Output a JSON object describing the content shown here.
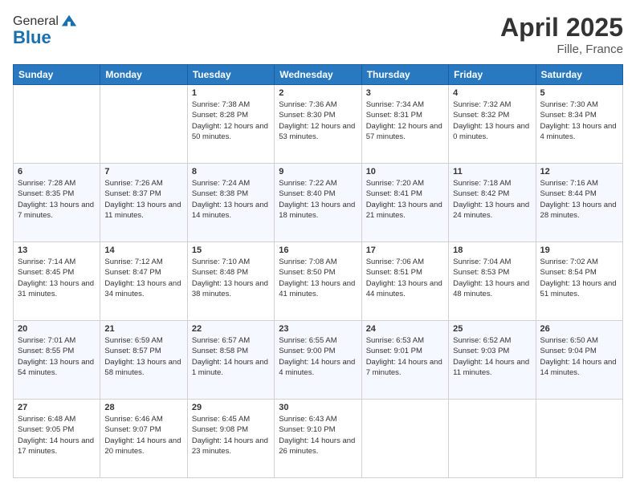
{
  "header": {
    "logo_general": "General",
    "logo_blue": "Blue",
    "title": "April 2025",
    "location": "Fille, France"
  },
  "days_of_week": [
    "Sunday",
    "Monday",
    "Tuesday",
    "Wednesday",
    "Thursday",
    "Friday",
    "Saturday"
  ],
  "weeks": [
    [
      {
        "day": "",
        "sunrise": "",
        "sunset": "",
        "daylight": ""
      },
      {
        "day": "",
        "sunrise": "",
        "sunset": "",
        "daylight": ""
      },
      {
        "day": "1",
        "sunrise": "Sunrise: 7:38 AM",
        "sunset": "Sunset: 8:28 PM",
        "daylight": "Daylight: 12 hours and 50 minutes."
      },
      {
        "day": "2",
        "sunrise": "Sunrise: 7:36 AM",
        "sunset": "Sunset: 8:30 PM",
        "daylight": "Daylight: 12 hours and 53 minutes."
      },
      {
        "day": "3",
        "sunrise": "Sunrise: 7:34 AM",
        "sunset": "Sunset: 8:31 PM",
        "daylight": "Daylight: 12 hours and 57 minutes."
      },
      {
        "day": "4",
        "sunrise": "Sunrise: 7:32 AM",
        "sunset": "Sunset: 8:32 PM",
        "daylight": "Daylight: 13 hours and 0 minutes."
      },
      {
        "day": "5",
        "sunrise": "Sunrise: 7:30 AM",
        "sunset": "Sunset: 8:34 PM",
        "daylight": "Daylight: 13 hours and 4 minutes."
      }
    ],
    [
      {
        "day": "6",
        "sunrise": "Sunrise: 7:28 AM",
        "sunset": "Sunset: 8:35 PM",
        "daylight": "Daylight: 13 hours and 7 minutes."
      },
      {
        "day": "7",
        "sunrise": "Sunrise: 7:26 AM",
        "sunset": "Sunset: 8:37 PM",
        "daylight": "Daylight: 13 hours and 11 minutes."
      },
      {
        "day": "8",
        "sunrise": "Sunrise: 7:24 AM",
        "sunset": "Sunset: 8:38 PM",
        "daylight": "Daylight: 13 hours and 14 minutes."
      },
      {
        "day": "9",
        "sunrise": "Sunrise: 7:22 AM",
        "sunset": "Sunset: 8:40 PM",
        "daylight": "Daylight: 13 hours and 18 minutes."
      },
      {
        "day": "10",
        "sunrise": "Sunrise: 7:20 AM",
        "sunset": "Sunset: 8:41 PM",
        "daylight": "Daylight: 13 hours and 21 minutes."
      },
      {
        "day": "11",
        "sunrise": "Sunrise: 7:18 AM",
        "sunset": "Sunset: 8:42 PM",
        "daylight": "Daylight: 13 hours and 24 minutes."
      },
      {
        "day": "12",
        "sunrise": "Sunrise: 7:16 AM",
        "sunset": "Sunset: 8:44 PM",
        "daylight": "Daylight: 13 hours and 28 minutes."
      }
    ],
    [
      {
        "day": "13",
        "sunrise": "Sunrise: 7:14 AM",
        "sunset": "Sunset: 8:45 PM",
        "daylight": "Daylight: 13 hours and 31 minutes."
      },
      {
        "day": "14",
        "sunrise": "Sunrise: 7:12 AM",
        "sunset": "Sunset: 8:47 PM",
        "daylight": "Daylight: 13 hours and 34 minutes."
      },
      {
        "day": "15",
        "sunrise": "Sunrise: 7:10 AM",
        "sunset": "Sunset: 8:48 PM",
        "daylight": "Daylight: 13 hours and 38 minutes."
      },
      {
        "day": "16",
        "sunrise": "Sunrise: 7:08 AM",
        "sunset": "Sunset: 8:50 PM",
        "daylight": "Daylight: 13 hours and 41 minutes."
      },
      {
        "day": "17",
        "sunrise": "Sunrise: 7:06 AM",
        "sunset": "Sunset: 8:51 PM",
        "daylight": "Daylight: 13 hours and 44 minutes."
      },
      {
        "day": "18",
        "sunrise": "Sunrise: 7:04 AM",
        "sunset": "Sunset: 8:53 PM",
        "daylight": "Daylight: 13 hours and 48 minutes."
      },
      {
        "day": "19",
        "sunrise": "Sunrise: 7:02 AM",
        "sunset": "Sunset: 8:54 PM",
        "daylight": "Daylight: 13 hours and 51 minutes."
      }
    ],
    [
      {
        "day": "20",
        "sunrise": "Sunrise: 7:01 AM",
        "sunset": "Sunset: 8:55 PM",
        "daylight": "Daylight: 13 hours and 54 minutes."
      },
      {
        "day": "21",
        "sunrise": "Sunrise: 6:59 AM",
        "sunset": "Sunset: 8:57 PM",
        "daylight": "Daylight: 13 hours and 58 minutes."
      },
      {
        "day": "22",
        "sunrise": "Sunrise: 6:57 AM",
        "sunset": "Sunset: 8:58 PM",
        "daylight": "Daylight: 14 hours and 1 minute."
      },
      {
        "day": "23",
        "sunrise": "Sunrise: 6:55 AM",
        "sunset": "Sunset: 9:00 PM",
        "daylight": "Daylight: 14 hours and 4 minutes."
      },
      {
        "day": "24",
        "sunrise": "Sunrise: 6:53 AM",
        "sunset": "Sunset: 9:01 PM",
        "daylight": "Daylight: 14 hours and 7 minutes."
      },
      {
        "day": "25",
        "sunrise": "Sunrise: 6:52 AM",
        "sunset": "Sunset: 9:03 PM",
        "daylight": "Daylight: 14 hours and 11 minutes."
      },
      {
        "day": "26",
        "sunrise": "Sunrise: 6:50 AM",
        "sunset": "Sunset: 9:04 PM",
        "daylight": "Daylight: 14 hours and 14 minutes."
      }
    ],
    [
      {
        "day": "27",
        "sunrise": "Sunrise: 6:48 AM",
        "sunset": "Sunset: 9:05 PM",
        "daylight": "Daylight: 14 hours and 17 minutes."
      },
      {
        "day": "28",
        "sunrise": "Sunrise: 6:46 AM",
        "sunset": "Sunset: 9:07 PM",
        "daylight": "Daylight: 14 hours and 20 minutes."
      },
      {
        "day": "29",
        "sunrise": "Sunrise: 6:45 AM",
        "sunset": "Sunset: 9:08 PM",
        "daylight": "Daylight: 14 hours and 23 minutes."
      },
      {
        "day": "30",
        "sunrise": "Sunrise: 6:43 AM",
        "sunset": "Sunset: 9:10 PM",
        "daylight": "Daylight: 14 hours and 26 minutes."
      },
      {
        "day": "",
        "sunrise": "",
        "sunset": "",
        "daylight": ""
      },
      {
        "day": "",
        "sunrise": "",
        "sunset": "",
        "daylight": ""
      },
      {
        "day": "",
        "sunrise": "",
        "sunset": "",
        "daylight": ""
      }
    ]
  ]
}
